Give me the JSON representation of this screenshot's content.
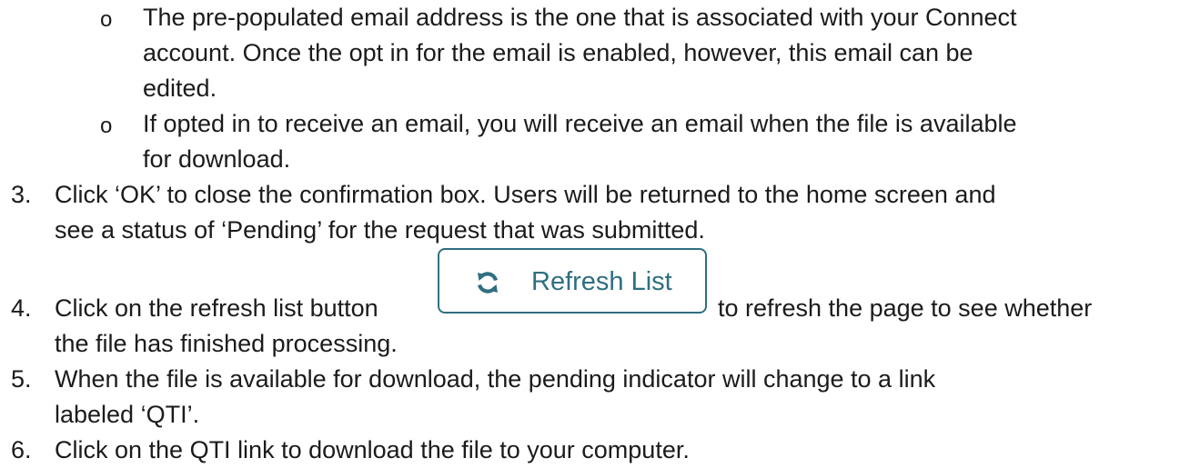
{
  "sub_bullets": [
    {
      "marker": "o",
      "lines": [
        "The pre-populated email address is the one that is associated with your Connect",
        "account. Once the opt in for the email is enabled, however, this email can be",
        "edited."
      ]
    },
    {
      "marker": "o",
      "lines": [
        "If opted in to receive an email, you will receive an email when the file is available",
        "for download."
      ]
    }
  ],
  "steps": [
    {
      "number": "3.",
      "lines": [
        "Click ‘OK’ to close the confirmation box. Users will be returned to the home screen and",
        "see a status of ‘Pending’ for the request that was submitted."
      ]
    },
    {
      "number": "4.",
      "before_button": "Click on the refresh list button",
      "after_button": "to refresh the page to see whether",
      "lines": [
        "the file has finished processing."
      ]
    },
    {
      "number": "5.",
      "lines": [
        "When the file is available for download, the pending indicator will change to a link",
        "labeled ‘QTI’."
      ]
    },
    {
      "number": "6.",
      "lines": [
        "Click on the QTI link to download the file to your computer."
      ]
    }
  ],
  "refresh_button": {
    "label": "Refresh List",
    "icon": "refresh-icon",
    "color": "#2f6f80"
  }
}
